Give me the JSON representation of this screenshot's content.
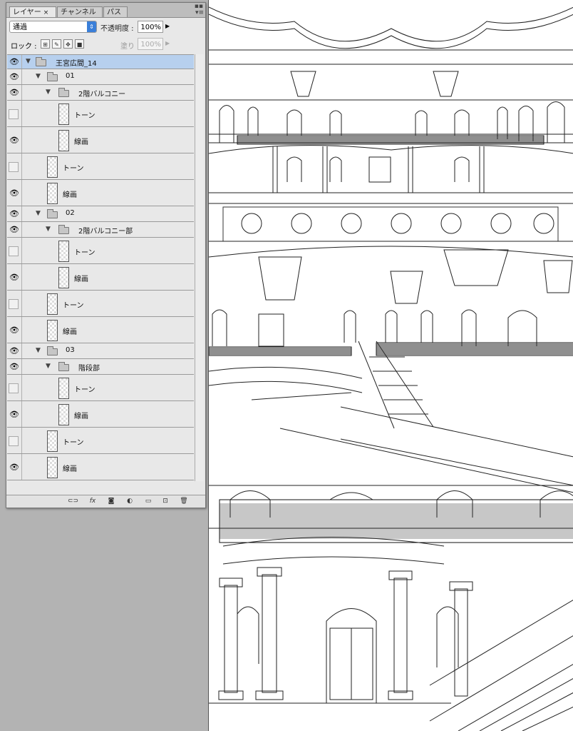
{
  "panel": {
    "tabs": [
      {
        "label": "レイヤー",
        "close": "×"
      },
      {
        "label": "チャンネル"
      },
      {
        "label": "パス"
      }
    ],
    "blend_mode": "通過",
    "opacity_label": "不透明度 :",
    "opacity_value": "100%",
    "lock_label": "ロック :",
    "fill_label": "塗り :",
    "fill_value": "100%"
  },
  "layers": [
    {
      "name": "王宮広間_14",
      "type": "group",
      "visible": true,
      "selected": true
    },
    {
      "name": "01",
      "type": "group",
      "visible": true
    },
    {
      "name": "2階バルコニー",
      "type": "group",
      "visible": true
    },
    {
      "name": "トーン",
      "type": "layer",
      "visible": false
    },
    {
      "name": "線画",
      "type": "layer",
      "visible": true
    },
    {
      "name": "トーン",
      "type": "layer",
      "visible": false
    },
    {
      "name": "線画",
      "type": "layer",
      "visible": true
    },
    {
      "name": "02",
      "type": "group",
      "visible": true
    },
    {
      "name": "2階バルコニー部",
      "type": "group",
      "visible": true
    },
    {
      "name": "トーン",
      "type": "layer",
      "visible": false
    },
    {
      "name": "線画",
      "type": "layer",
      "visible": true
    },
    {
      "name": "トーン",
      "type": "layer",
      "visible": false
    },
    {
      "name": "線画",
      "type": "layer",
      "visible": true
    },
    {
      "name": "03",
      "type": "group",
      "visible": true
    },
    {
      "name": "階段部",
      "type": "group",
      "visible": true
    },
    {
      "name": "トーン",
      "type": "layer",
      "visible": false
    },
    {
      "name": "線画",
      "type": "layer",
      "visible": true
    },
    {
      "name": "トーン",
      "type": "layer",
      "visible": false
    },
    {
      "name": "線画",
      "type": "layer",
      "visible": true
    }
  ],
  "bottom_icons": [
    "link-icon",
    "fx-icon",
    "mask-icon",
    "adjustment-icon",
    "new-group-icon",
    "new-layer-icon",
    "trash-icon"
  ],
  "fx_label": "fx"
}
